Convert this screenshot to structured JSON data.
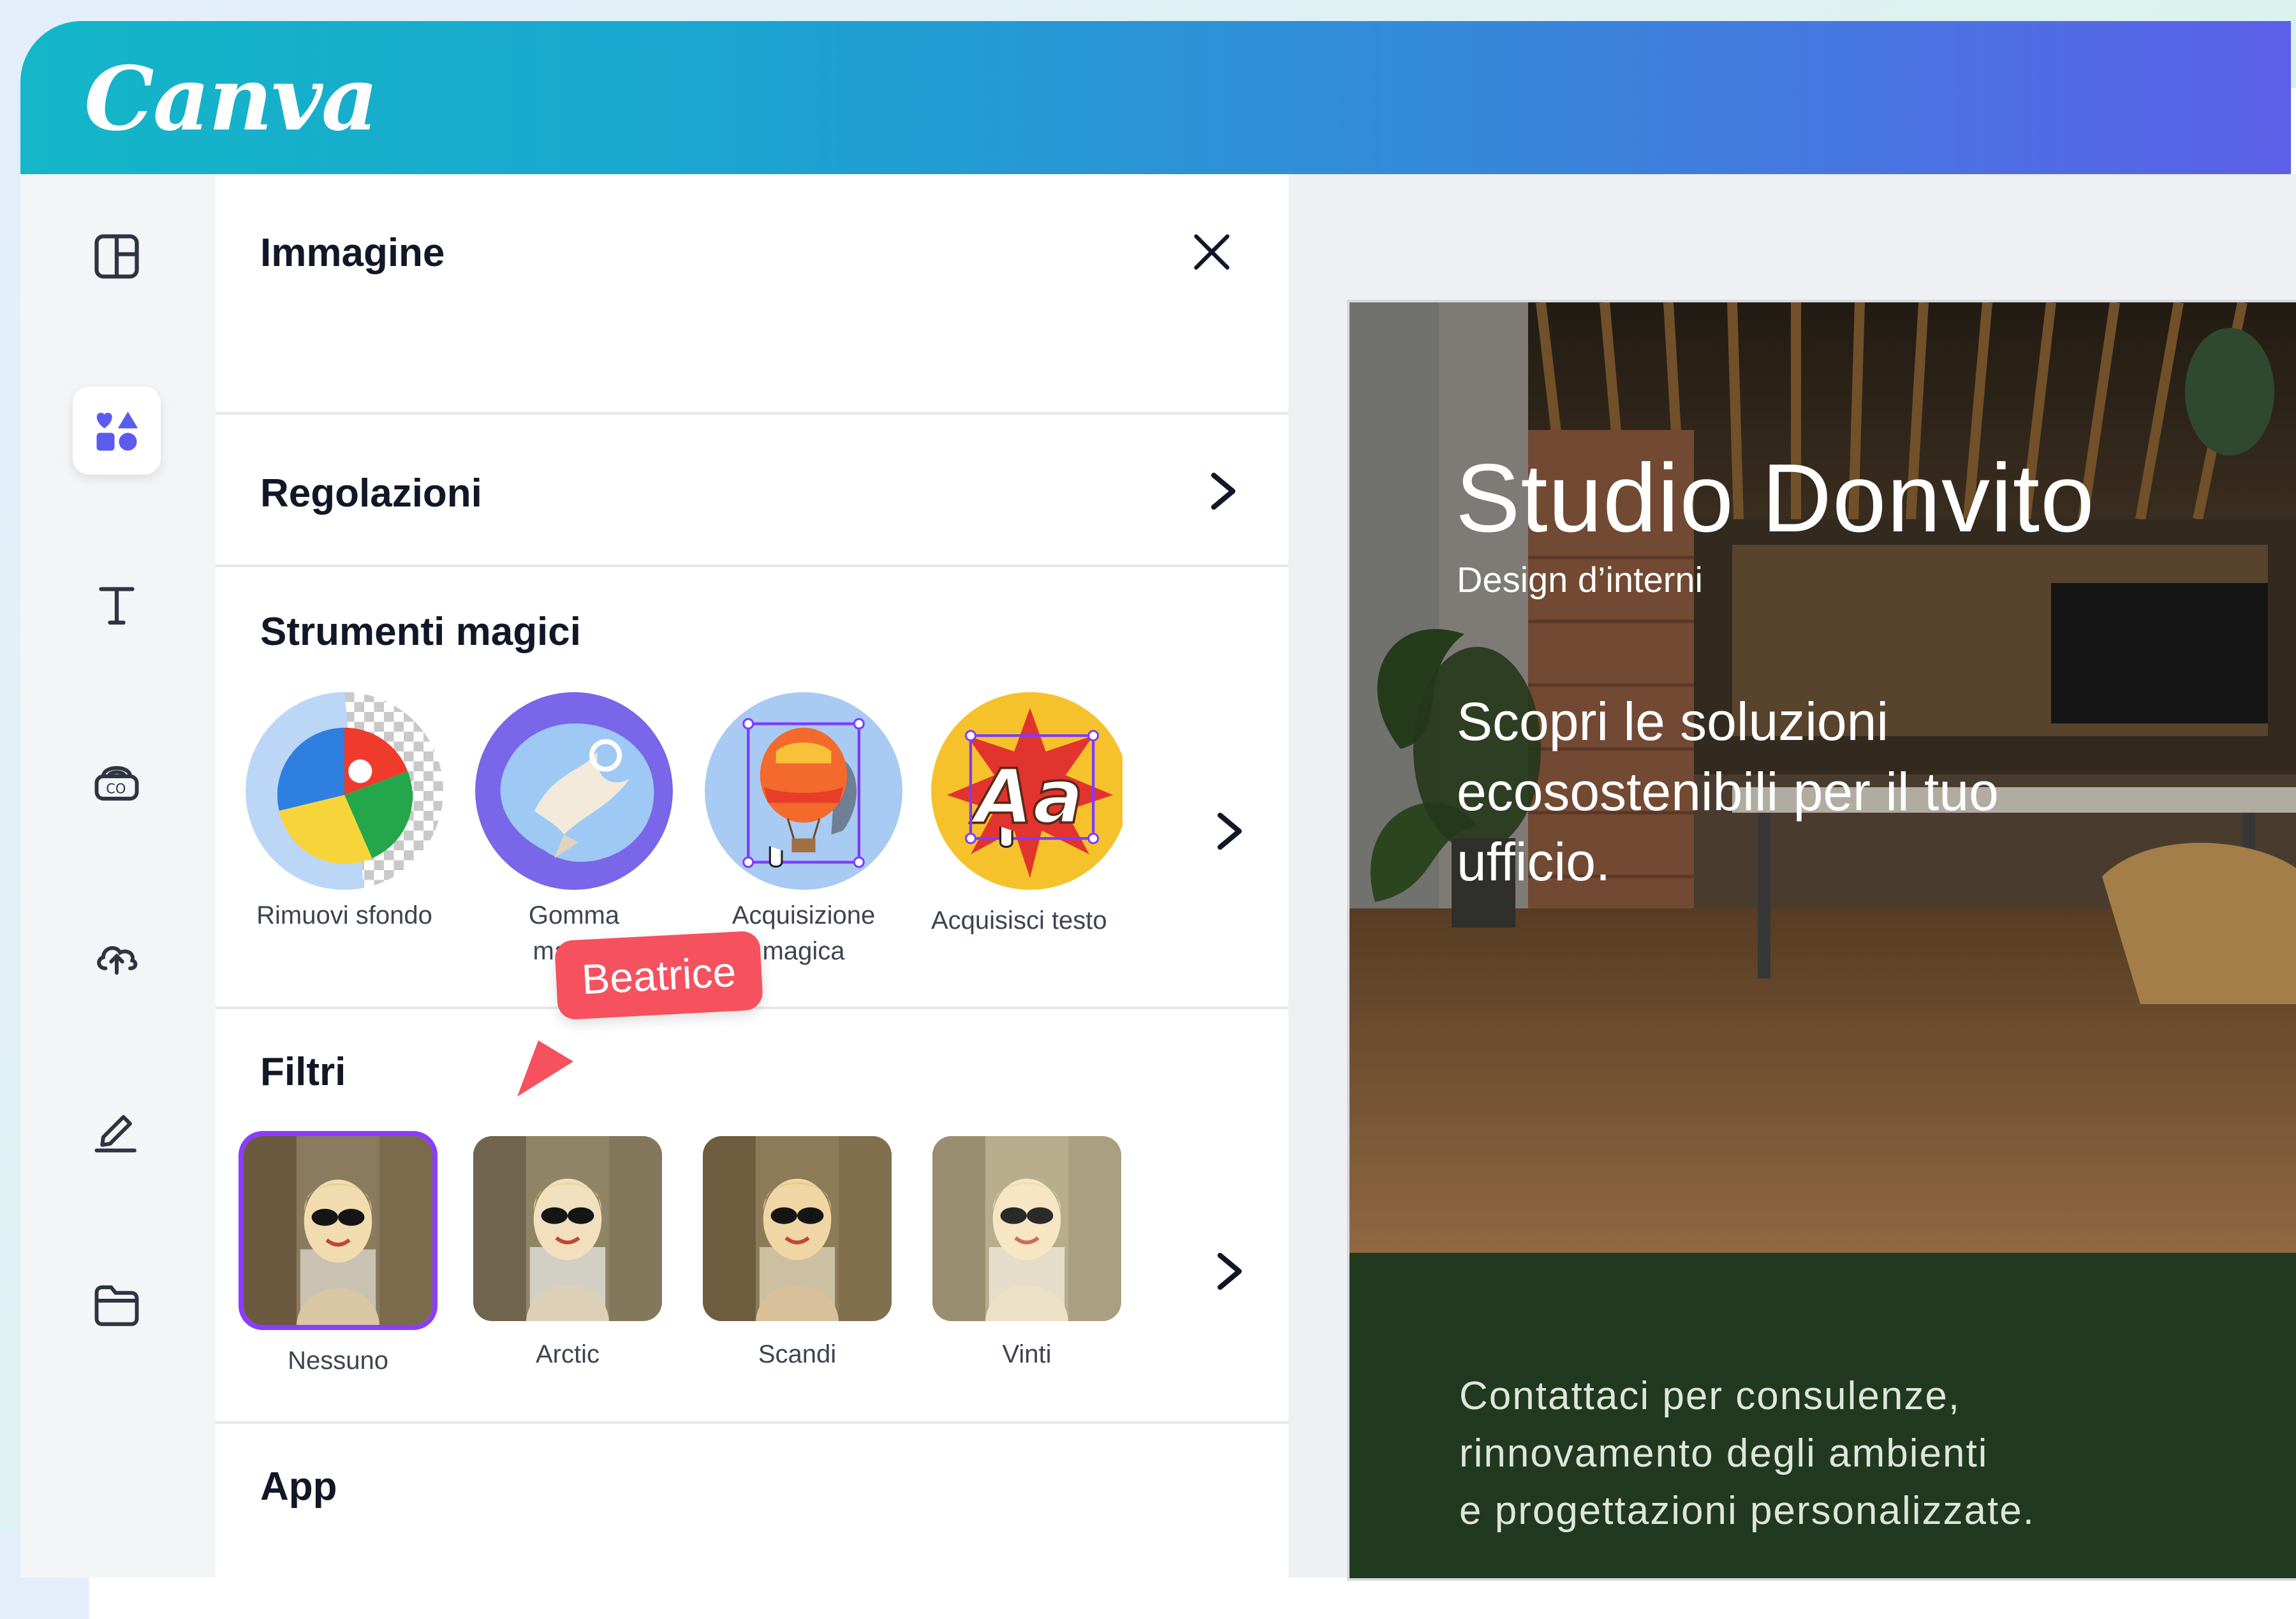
{
  "app": {
    "logo_text": "Canva"
  },
  "rail": {
    "items": [
      {
        "name": "design",
        "icon": "layout-icon"
      },
      {
        "name": "elements",
        "icon": "shapes-icon",
        "active": true
      },
      {
        "name": "text",
        "icon": "text-icon"
      },
      {
        "name": "brand",
        "icon": "brand-icon"
      },
      {
        "name": "uploads",
        "icon": "cloud-upload-icon"
      },
      {
        "name": "draw",
        "icon": "pen-icon"
      },
      {
        "name": "projects",
        "icon": "folder-icon"
      }
    ]
  },
  "panel": {
    "title": "Immagine",
    "adjustments_label": "Regolazioni",
    "magic_tools": {
      "heading": "Strumenti magici",
      "items": [
        {
          "label": "Rimuovi sfondo"
        },
        {
          "label": "Gomma\nmagica"
        },
        {
          "label": "Acquisizione\nmagica"
        },
        {
          "label": "Acquisisci testo"
        }
      ]
    },
    "filters": {
      "heading": "Filtri",
      "items": [
        {
          "label": "Nessuno",
          "selected": true
        },
        {
          "label": "Arctic"
        },
        {
          "label": "Scandi"
        },
        {
          "label": "Vinti"
        }
      ]
    },
    "apps_heading": "App"
  },
  "collaborator": {
    "name": "Beatrice",
    "color": "#f5515f"
  },
  "design": {
    "title": "Studio Donvito",
    "subtitle": "Design d’interni",
    "tagline": "Scopri le soluzioni ecosostenibili per il tuo ufficio.",
    "contact_lines": [
      "Contattaci per consulenze,",
      "rinnovamento degli ambienti",
      "e progettazioni personalizzate."
    ],
    "bottom_color": "#21391f"
  },
  "colors": {
    "accent": "#8b3dff",
    "header_start": "#14b6c8",
    "header_end": "#5c60e8"
  }
}
